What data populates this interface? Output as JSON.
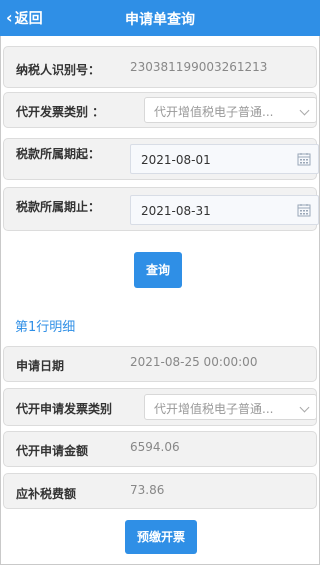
{
  "header": {
    "back_label": "返回",
    "title": "申请单查询"
  },
  "form": {
    "taxpayer_id_label": "纳税人识别号：",
    "taxpayer_id_value": "230381199003261213",
    "invoice_type_label": "代开发票类别 ：",
    "invoice_type_value": "代开增值税电子普通...",
    "period_start_label": "税款所属期起：",
    "period_start_value": "2021-08-01",
    "period_end_label": "税款所属期止：",
    "period_end_value": "2021-08-31",
    "query_button": "查询"
  },
  "detail": {
    "section_title": "第1行明细",
    "apply_date_label": "申请日期",
    "apply_date_value": "2021-08-25 00:00:00",
    "apply_invoice_type_label": "代开申请发票类别",
    "apply_invoice_type_value": "代开增值税电子普通...",
    "apply_amount_label": "代开申请金额",
    "apply_amount_value": "6594.06",
    "tax_due_label": "应补税费额",
    "tax_due_value": "73.86",
    "prepay_button": "预缴开票"
  },
  "colors": {
    "accent": "#2f8fe6"
  },
  "icons": {
    "back": "chevron-left-icon",
    "select": "chevron-down-icon",
    "date": "calendar-icon"
  }
}
